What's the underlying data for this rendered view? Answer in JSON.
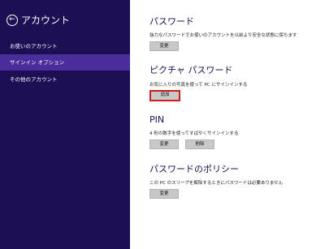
{
  "sidebar": {
    "back_icon": "back-arrow-icon",
    "title": "アカウント",
    "items": [
      {
        "label": "お使いのアカウント"
      },
      {
        "label": "サインイン オプション",
        "selected": true
      },
      {
        "label": "その他のアカウント"
      }
    ]
  },
  "main": {
    "password": {
      "title": "パスワード",
      "description": "強力なパスワードでお使いのアカウントを以前より安全な状態に保ちます",
      "change_label": "変更"
    },
    "picture_password": {
      "title": "ピクチャ パスワード",
      "description": "お気に入りの写真を使って PC にサインインする",
      "add_label": "追加"
    },
    "pin": {
      "title": "PIN",
      "description": "4 桁の数字を使ってすばやくサインインする",
      "change_label": "変更",
      "delete_label": "削除"
    },
    "password_policy": {
      "title": "パスワードのポリシー",
      "description": "この PC のスリープを解除するときにパスワードは必要ありません",
      "change_label": "変更"
    }
  },
  "colors": {
    "sidebar_bg": "#1d0f54",
    "selected_bg": "#4a2d9a",
    "title_color": "#1d0f54",
    "highlight_border": "#d11c1c"
  }
}
